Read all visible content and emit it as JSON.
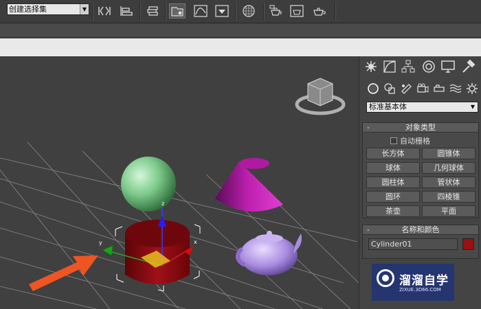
{
  "toolbar": {
    "selection_set_value": "创建选择集",
    "icons": [
      "mirror-icon",
      "align-icon",
      "layer-manager-icon",
      "scene-explorer-icon",
      "curve-editor-icon",
      "schematic-view-icon",
      "material-editor-icon",
      "render-setup-icon",
      "rendered-frame-icon",
      "render-icon"
    ]
  },
  "panel": {
    "tabs": [
      "create-icon",
      "modify-icon",
      "hierarchy-icon",
      "motion-icon",
      "display-icon",
      "utilities-icon"
    ],
    "categories": [
      "geometry-icon",
      "shapes-icon",
      "lights-icon",
      "cameras-icon",
      "helpers-icon",
      "space-warps-icon",
      "systems-icon"
    ],
    "type_dropdown": "标准基本体",
    "object_type": {
      "header": "对象类型",
      "autogrid_label": "自动栅格",
      "buttons": [
        "长方体",
        "圆锥体",
        "球体",
        "几何球体",
        "圆柱体",
        "管状体",
        "圆环",
        "四棱锥",
        "茶壶",
        "平面"
      ]
    },
    "name_color": {
      "header": "名称和颜色",
      "name_value": "Cylinder01",
      "color": "#9c1010"
    }
  },
  "viewport": {
    "gizmo_axes": {
      "x": "x",
      "y": "y",
      "z": "z"
    },
    "objects": [
      "sphere",
      "cone",
      "cylinder",
      "teapot"
    ],
    "colors": {
      "sphere": "#7cc98a",
      "cone": "#c020b0",
      "cylinder": "#8a0a10",
      "teapot": "#a98be0",
      "arrow": "#ee5522"
    }
  },
  "watermark": {
    "title": "溜溜自学",
    "url": "ZIXUE.3D66.COM"
  }
}
